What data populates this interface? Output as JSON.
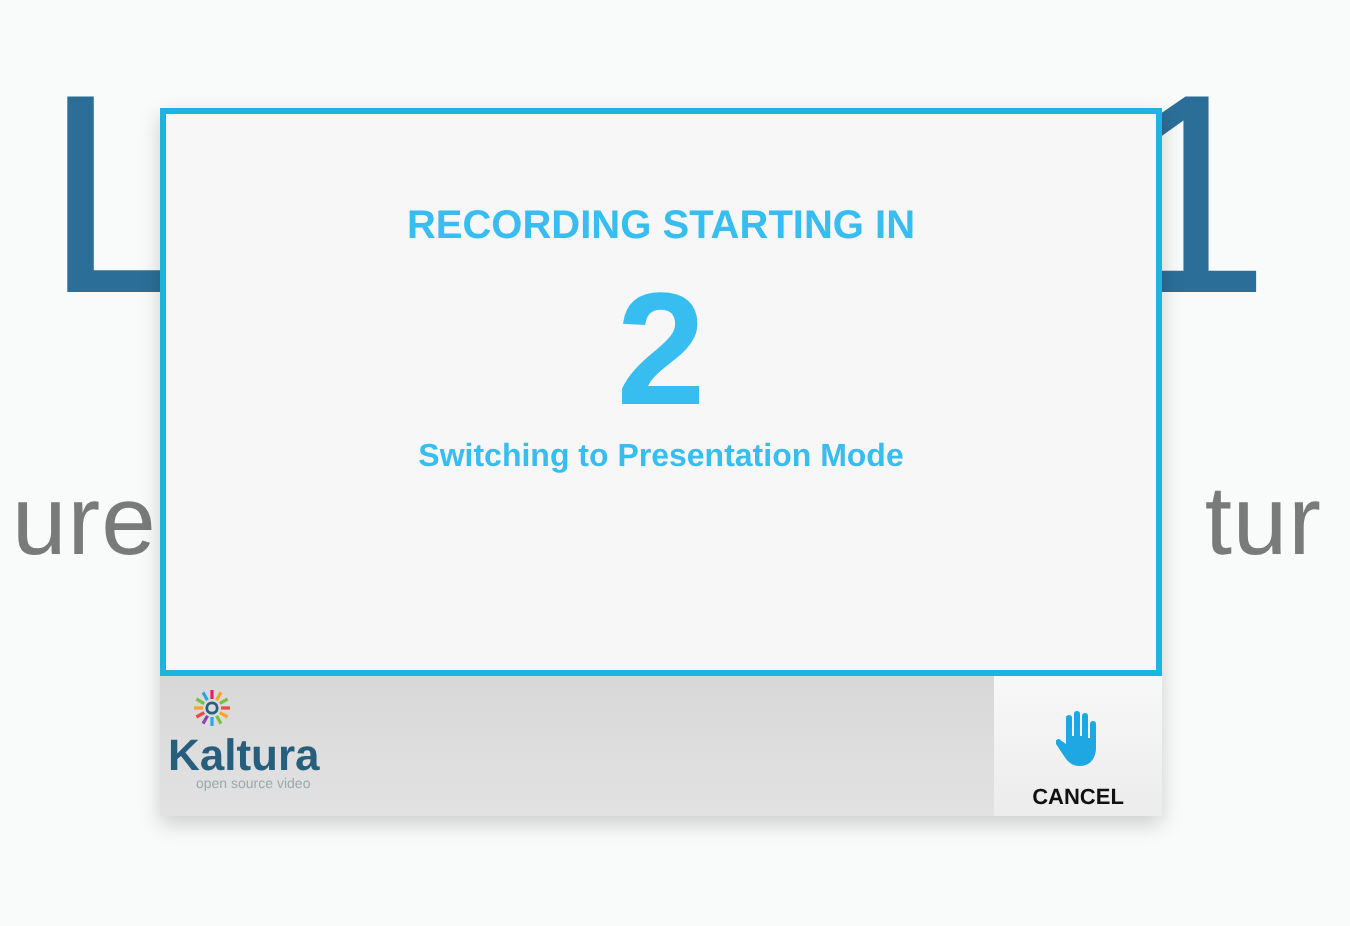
{
  "slide": {
    "title_parts": [
      "L",
      "1"
    ],
    "subtitle_parts": [
      "ure",
      "tur"
    ]
  },
  "dialog": {
    "heading": "RECORDING STARTING IN",
    "countdown": "2",
    "message": "Switching to Presentation Mode"
  },
  "footer": {
    "logo": {
      "name": "Kaltura",
      "tagline": "open source video"
    },
    "cancel_button": "CANCEL"
  }
}
